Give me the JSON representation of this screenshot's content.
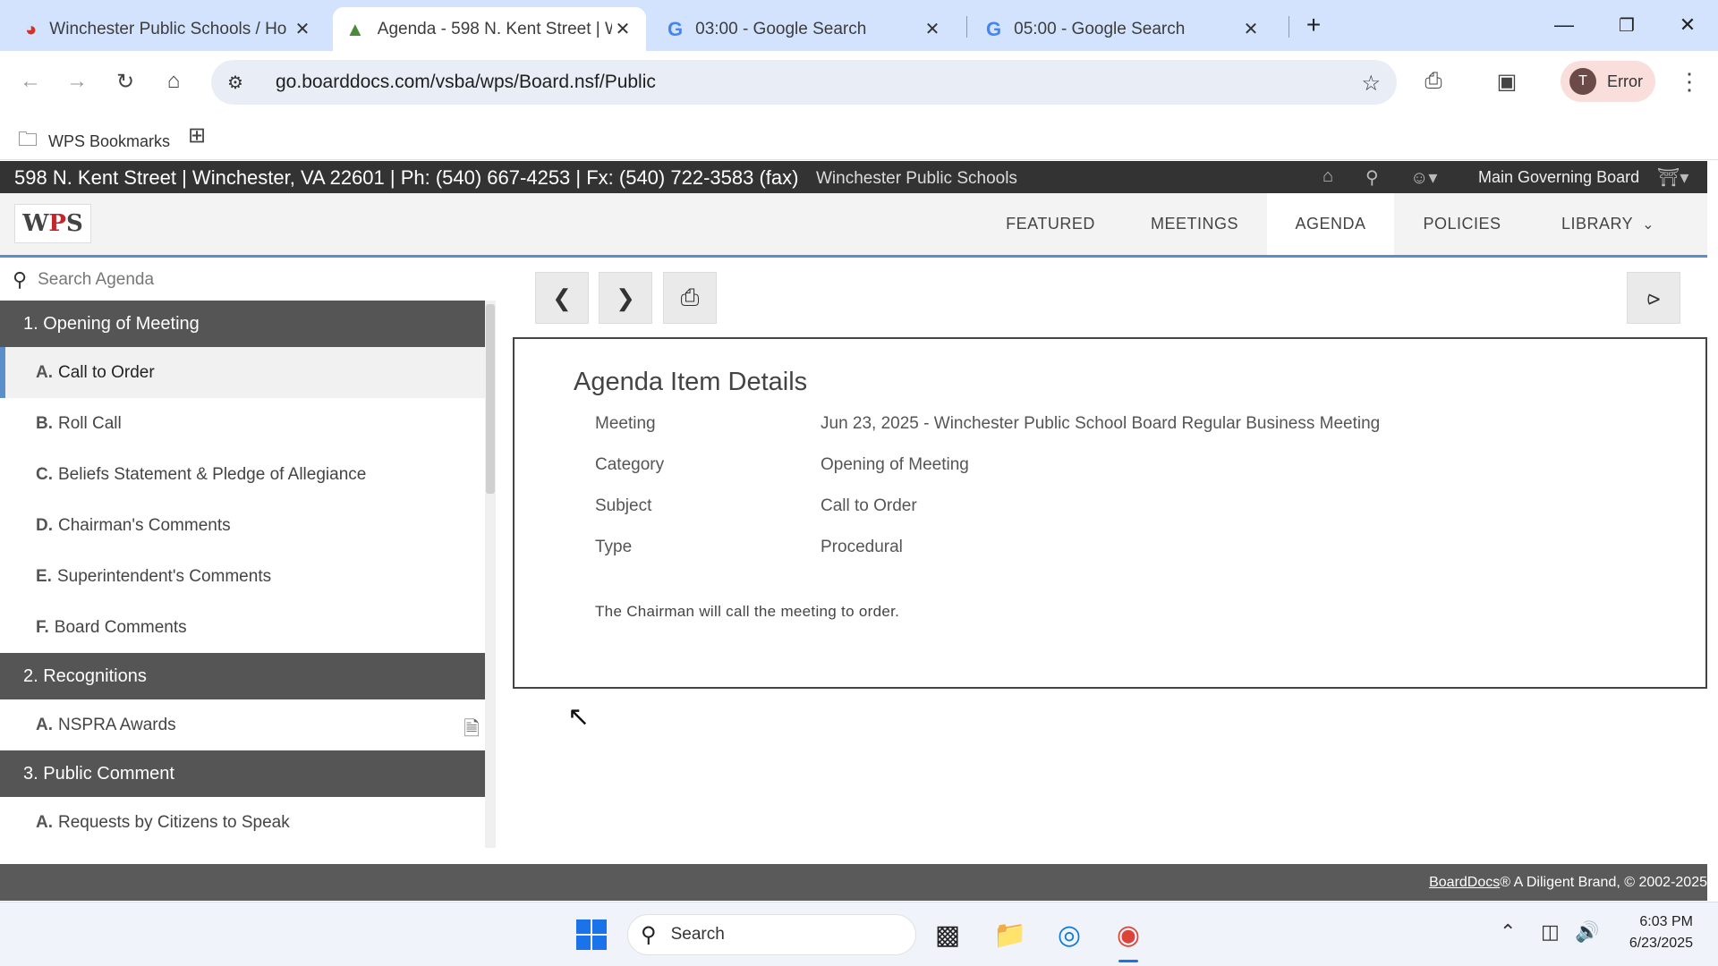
{
  "browser": {
    "tabs": [
      {
        "title": "Winchester Public Schools / Ho",
        "favicon": "wps-favicon",
        "active": false
      },
      {
        "title": "Agenda - 598 N. Kent Street | W",
        "favicon": "boarddocs-tree-favicon",
        "active": true
      },
      {
        "title": "03:00 - Google Search",
        "favicon": "google-favicon",
        "active": false
      },
      {
        "title": "05:00 - Google Search",
        "favicon": "google-favicon",
        "active": false
      }
    ],
    "url": "go.boarddocs.com/vsba/wps/Board.nsf/Public",
    "profile_initial": "T",
    "profile_status": "Error",
    "bookmark_folder": "WPS Bookmarks"
  },
  "site": {
    "address": "598 N. Kent Street | Winchester, VA 22601 | Ph: (540) 667-4253 | Fx: (540) 722-3583 (fax)",
    "org": "Winchester Public Schools",
    "board": "Main Governing Board",
    "logo_text": "WPS",
    "nav": [
      "FEATURED",
      "MEETINGS",
      "AGENDA",
      "POLICIES",
      "LIBRARY"
    ],
    "active_nav": "AGENDA"
  },
  "sidebar": {
    "search_placeholder": "Search Agenda",
    "sections": [
      {
        "title": "1. Opening of Meeting",
        "items": [
          {
            "letter": "A.",
            "label": "Call to Order",
            "selected": true
          },
          {
            "letter": "B.",
            "label": "Roll Call"
          },
          {
            "letter": "C.",
            "label": "Beliefs Statement & Pledge of Allegiance"
          },
          {
            "letter": "D.",
            "label": "Chairman's Comments"
          },
          {
            "letter": "E.",
            "label": "Superintendent's Comments"
          },
          {
            "letter": "F.",
            "label": "Board Comments"
          }
        ]
      },
      {
        "title": "2. Recognitions",
        "items": [
          {
            "letter": "A.",
            "label": "NSPRA Awards",
            "has_attachment": true
          }
        ]
      },
      {
        "title": "3. Public Comment",
        "items": [
          {
            "letter": "A.",
            "label": "Requests by Citizens to Speak"
          }
        ]
      }
    ]
  },
  "detail": {
    "heading": "Agenda Item Details",
    "fields": [
      {
        "label": "Meeting",
        "value": "Jun 23, 2025 - Winchester Public School Board Regular Business Meeting"
      },
      {
        "label": "Category",
        "value": "Opening of Meeting"
      },
      {
        "label": "Subject",
        "value": "Call to Order"
      },
      {
        "label": "Type",
        "value": "Procedural"
      }
    ],
    "body": "The Chairman will call the meeting to order."
  },
  "footer": {
    "link": "BoardDocs",
    "text": "® A Diligent Brand, © 2002-2025"
  },
  "taskbar": {
    "search_label": "Search",
    "time": "6:03 PM",
    "date": "6/23/2025"
  }
}
